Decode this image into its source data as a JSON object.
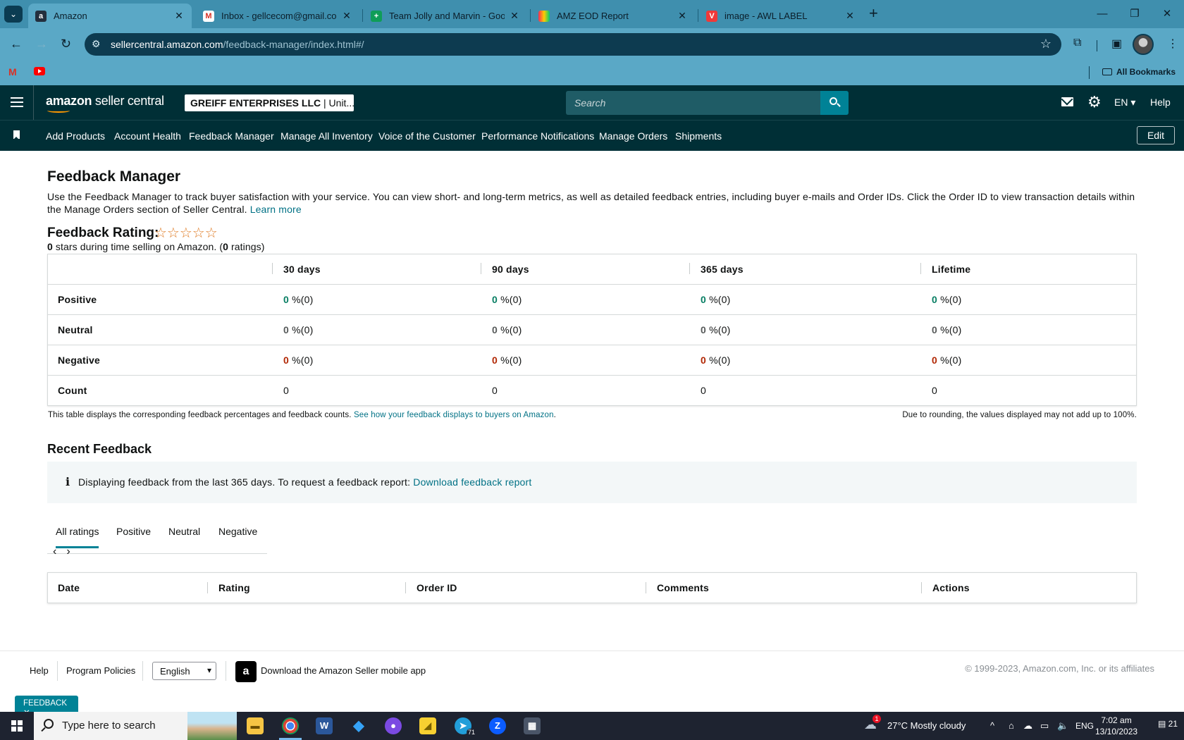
{
  "browser": {
    "tabs": [
      {
        "title": "Amazon",
        "favicon": "amazon-icon",
        "active": true
      },
      {
        "title": "Inbox - gellcecom@gmail.com",
        "favicon": "gmail-icon"
      },
      {
        "title": "Team Jolly and Marvin - Googl",
        "favicon": "sheets-icon"
      },
      {
        "title": "AMZ EOD Report",
        "favicon": "monday-icon"
      },
      {
        "title": "image - AWL LABEL",
        "favicon": "vivaldi-icon"
      }
    ],
    "url_domain": "sellercentral.amazon.com",
    "url_path": "/feedback-manager/index.html#/",
    "bookmarks_label": "All Bookmarks"
  },
  "header": {
    "logo_brand": "amazon",
    "logo_product": " seller central",
    "account": "GREIFF ENTERPRISES LLC",
    "account_sep": " | Unit...",
    "search_placeholder": "Search",
    "lang": "EN",
    "help": "Help"
  },
  "nav": {
    "links": [
      "Add Products",
      "Account Health",
      "Feedback Manager",
      "Manage All Inventory",
      "Voice of the Customer",
      "Performance Notifications",
      "Manage Orders",
      "Shipments"
    ],
    "edit": "Edit"
  },
  "page": {
    "title": "Feedback Manager",
    "intro": "Use the Feedback Manager to track buyer satisfaction with your service. You can view short- and long-term metrics, as well as detailed feedback entries, including buyer e-mails and Order IDs. Click the Order ID to view transaction details within the Manage Orders section of Seller Central.",
    "learn_more": "Learn more",
    "rating_title": "Feedback Rating:",
    "stars": "☆☆☆☆☆",
    "rating_stars_value": "0",
    "rating_sub_mid": " stars during time selling on Amazon. (",
    "rating_count": "0",
    "rating_sub_end": " ratings)"
  },
  "feedback_table": {
    "columns": [
      "30 days",
      "90 days",
      "365 days",
      "Lifetime"
    ],
    "rows": [
      {
        "label": "Positive",
        "values": [
          "0",
          "0",
          "0",
          "0"
        ],
        "counts": [
          " %(0)",
          " %(0)",
          " %(0)",
          " %(0)"
        ]
      },
      {
        "label": "Neutral",
        "values": [
          "0",
          "0",
          "0",
          "0"
        ],
        "counts": [
          " %(0)",
          " %(0)",
          " %(0)",
          " %(0)"
        ]
      },
      {
        "label": "Negative",
        "values": [
          "0",
          "0",
          "0",
          "0"
        ],
        "counts": [
          " %(0)",
          " %(0)",
          " %(0)",
          " %(0)"
        ]
      },
      {
        "label": "Count",
        "values": [
          "0",
          "0",
          "0",
          "0"
        ]
      }
    ],
    "note": "This table displays the corresponding feedback percentages and feedback counts.",
    "note_link": "See how your feedback displays to buyers on Amazon",
    "note_link_end": ".",
    "rounding_note": "Due to rounding, the values displayed may not add up to 100%."
  },
  "recent": {
    "title": "Recent Feedback",
    "info": "Displaying feedback from the last 365 days. To request a feedback report:",
    "info_link": "Download feedback report",
    "tabs": [
      "All ratings",
      "Positive",
      "Neutral",
      "Negative"
    ],
    "columns": [
      "Date",
      "Rating",
      "Order ID",
      "Comments",
      "Actions"
    ]
  },
  "footer": {
    "help": "Help",
    "policies": "Program Policies",
    "language": "English",
    "app": "Download the Amazon Seller mobile app",
    "copyright": "© 1999-2023, Amazon.com, Inc. or its affiliates",
    "feedback_tab": "FEEDBACK"
  },
  "taskbar": {
    "search": "Type here to search",
    "weather": "27°C  Mostly cloudy",
    "lang": "ENG",
    "time": "7:02 am",
    "date": "13/10/2023",
    "notifications": "21",
    "telegram_badge": "71",
    "weather_badge": "1"
  }
}
